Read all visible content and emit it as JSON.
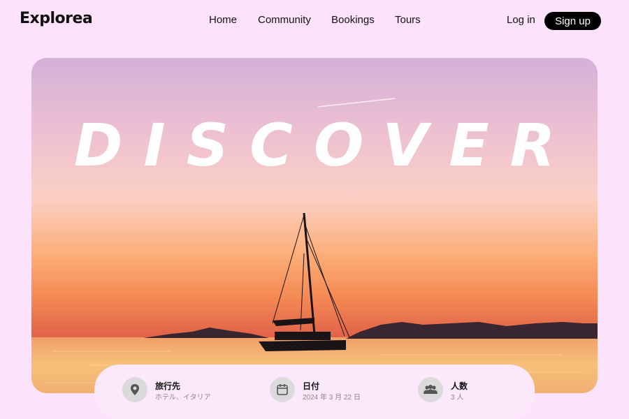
{
  "brand": {
    "name": "Explorea"
  },
  "nav": [
    {
      "label": "Home"
    },
    {
      "label": "Community"
    },
    {
      "label": "Bookings"
    },
    {
      "label": "Tours"
    }
  ],
  "auth": {
    "login_label": "Log in",
    "signup_label": "Sign up"
  },
  "hero": {
    "title": "DISCOVER"
  },
  "search": {
    "fields": [
      {
        "label": "旅行先",
        "value": "ホテル、イタリア",
        "icon": "location-pin-icon"
      },
      {
        "label": "日付",
        "value": "2024 年 3 月 22 日",
        "icon": "calendar-icon"
      },
      {
        "label": "人数",
        "value": "3 人",
        "icon": "people-icon"
      }
    ]
  },
  "colors": {
    "background": "#fde2fb",
    "signup_bg": "#000000",
    "search_bg": "#fce8fb",
    "icon_circle": "#dcd9dc"
  }
}
